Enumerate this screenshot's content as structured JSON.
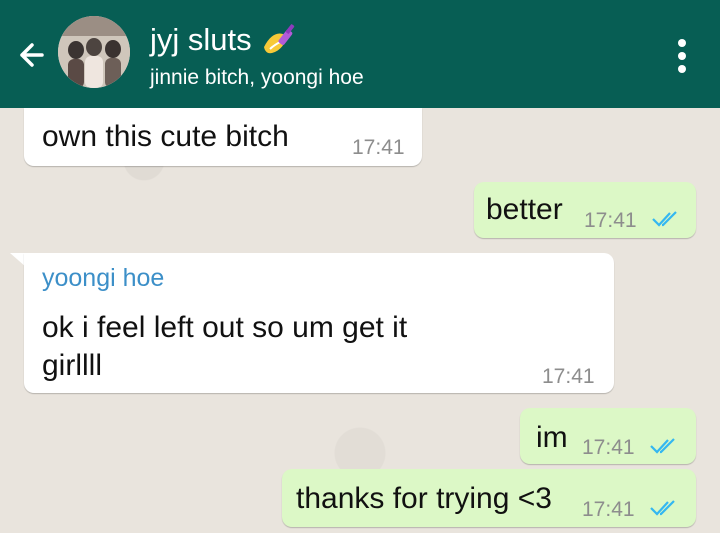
{
  "header": {
    "title": "jyj sluts",
    "subtitle": "jinnie bitch, yoongi hoe"
  },
  "colors": {
    "header": "#075e54",
    "incoming_bubble": "#ffffff",
    "outgoing_bubble": "#dcf8c6",
    "sender_name": "#3c8fc8",
    "read_ticks": "#34b7f1"
  },
  "messages": [
    {
      "text": "own this cute bitch",
      "time": "17:41"
    },
    {
      "text": "better",
      "time": "17:41"
    },
    {
      "sender": "yoongi hoe",
      "text_line1": "ok i feel left out so um get it",
      "text_line2": "girllll",
      "time": "17:41"
    },
    {
      "text": "im",
      "time": "17:41"
    },
    {
      "text": "thanks for trying <3",
      "time": "17:41"
    }
  ],
  "icons": {
    "back": "arrow-left-icon",
    "title_emoji": "nail-polish-icon",
    "menu": "more-vertical-icon",
    "read_receipt": "double-check-icon"
  }
}
